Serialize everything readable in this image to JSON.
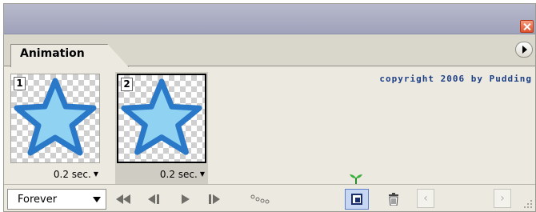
{
  "panel": {
    "tab_label": "Animation",
    "copyright": "copyright 2006 by Pudding"
  },
  "frames": [
    {
      "number": "1",
      "delay": "0.2 sec.",
      "selected": false
    },
    {
      "number": "2",
      "delay": "0.2 sec.",
      "selected": true
    }
  ],
  "toolbar": {
    "loop_value": "Forever",
    "buttons": [
      "first-frame",
      "previous-frame",
      "play",
      "next-frame",
      "tween",
      "duplicate-frame",
      "delete-frame"
    ]
  },
  "colors": {
    "star_fill": "#8fd2f2",
    "star_stroke": "#2a78c8",
    "accent_selected": "#c7d6f2",
    "copyright_text": "#1d3f86"
  },
  "icons": {
    "close": "close-icon",
    "panel_menu": "menu-arrow-icon",
    "first": "first-frame-icon",
    "prev": "previous-frame-icon",
    "play": "play-icon",
    "next": "next-frame-icon",
    "tween": "tween-icon",
    "duplicate": "duplicate-frame-icon",
    "trash": "trash-icon"
  }
}
